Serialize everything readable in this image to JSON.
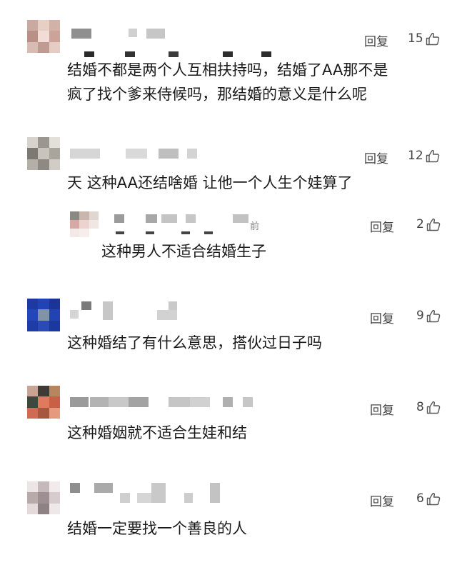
{
  "reply_label": "回复",
  "comments": [
    {
      "likes": "15",
      "lines": [
        "结婚不都是两个人互相扶持吗，结婚了AA那不是",
        "疯了找个爹来侍候吗，那结婚的意义是什么呢"
      ]
    },
    {
      "likes": "12",
      "lines": [
        "天 这种AA还结啥婚 让他一个人生个娃算了"
      ]
    },
    {
      "likes": "2",
      "name_suffix": "前",
      "lines": [
        "这种男人不适合结婚生子"
      ]
    },
    {
      "likes": "9",
      "lines": [
        "这种婚结了有什么意思，搭伙过日子吗"
      ]
    },
    {
      "likes": "8",
      "lines": [
        "这种婚姻就不适合生娃和结"
      ]
    },
    {
      "likes": "6",
      "lines": [
        "结婚一定要找一个善良的人"
      ]
    }
  ]
}
